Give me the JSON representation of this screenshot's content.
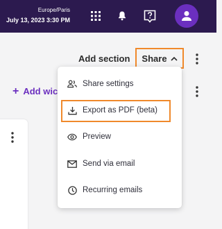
{
  "header": {
    "timezone": "Europe/Paris",
    "datetime": "July 13, 2023 3:30 PM",
    "icons": [
      "apps-grid-icon",
      "bell-icon",
      "help-icon",
      "user-avatar-icon"
    ]
  },
  "toolbar": {
    "add_section_label": "Add section",
    "share_label": "Share",
    "add_widget_label": "Add wic"
  },
  "share_menu": {
    "items": [
      {
        "label": "Share settings",
        "icon": "people-icon"
      },
      {
        "label": "Export as PDF (beta)",
        "icon": "download-icon"
      },
      {
        "label": "Preview",
        "icon": "eye-icon"
      },
      {
        "label": "Send via email",
        "icon": "mail-icon"
      },
      {
        "label": "Recurring emails",
        "icon": "clock-icon"
      }
    ]
  },
  "colors": {
    "header_bg": "#2c1a4f",
    "accent_purple": "#6b2fbf",
    "highlight_orange": "#f0892b"
  }
}
